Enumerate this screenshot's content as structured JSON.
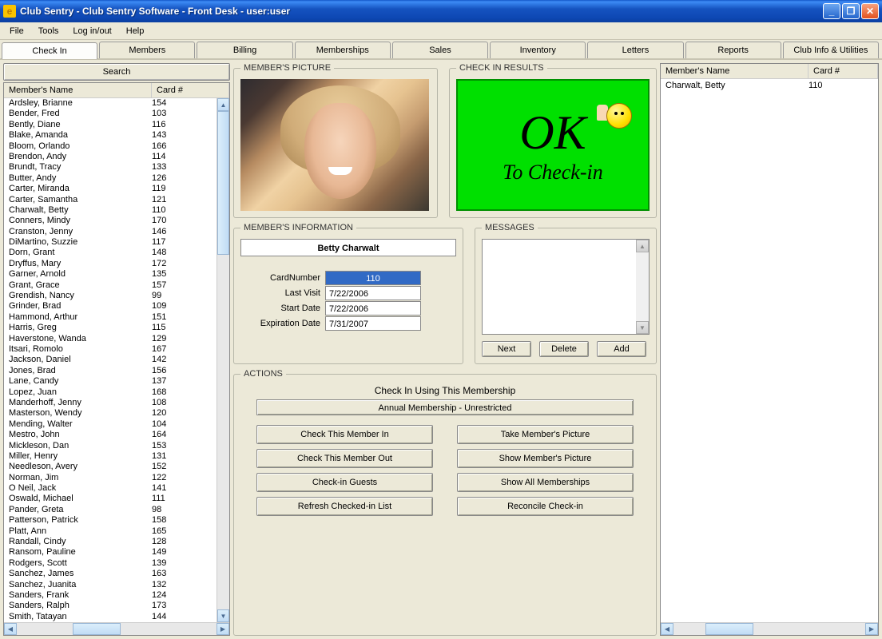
{
  "window": {
    "title": "Club Sentry - Club Sentry Software - Front Desk - user:user"
  },
  "menu": [
    "File",
    "Tools",
    "Log in/out",
    "Help"
  ],
  "tabs": [
    "Check In",
    "Members",
    "Billing",
    "Memberships",
    "Sales",
    "Inventory",
    "Letters",
    "Reports",
    "Club Info & Utilities"
  ],
  "search_label": "Search",
  "list": {
    "headers": {
      "name": "Member's Name",
      "card": "Card #"
    },
    "rows": [
      {
        "name": "Ardsley, Brianne",
        "card": "154"
      },
      {
        "name": "Bender, Fred",
        "card": "103"
      },
      {
        "name": "Bently, Diane",
        "card": "116"
      },
      {
        "name": "Blake, Amanda",
        "card": "143"
      },
      {
        "name": "Bloom, Orlando",
        "card": "166"
      },
      {
        "name": "Brendon, Andy",
        "card": "114"
      },
      {
        "name": "Brundt, Tracy",
        "card": "133"
      },
      {
        "name": "Butter, Andy",
        "card": "126"
      },
      {
        "name": "Carter, Miranda",
        "card": "119"
      },
      {
        "name": "Carter, Samantha",
        "card": "121"
      },
      {
        "name": "Charwalt, Betty",
        "card": "110"
      },
      {
        "name": "Conners, Mindy",
        "card": "170"
      },
      {
        "name": "Cranston, Jenny",
        "card": "146"
      },
      {
        "name": "DiMartino, Suzzie",
        "card": "117"
      },
      {
        "name": "Dorn, Grant",
        "card": "148"
      },
      {
        "name": "Dryffus, Mary",
        "card": "172"
      },
      {
        "name": "Garner, Arnold",
        "card": "135"
      },
      {
        "name": "Grant, Grace",
        "card": "157"
      },
      {
        "name": "Grendish, Nancy",
        "card": "99"
      },
      {
        "name": "Grinder, Brad",
        "card": "109"
      },
      {
        "name": "Hammond, Arthur",
        "card": "151"
      },
      {
        "name": "Harris, Greg",
        "card": "115"
      },
      {
        "name": "Haverstone, Wanda",
        "card": "129"
      },
      {
        "name": "Itsari, Romolo",
        "card": "167"
      },
      {
        "name": "Jackson, Daniel",
        "card": "142"
      },
      {
        "name": "Jones, Brad",
        "card": "156"
      },
      {
        "name": "Lane, Candy",
        "card": "137"
      },
      {
        "name": "Lopez, Juan",
        "card": "168"
      },
      {
        "name": "Manderhoff, Jenny",
        "card": "108"
      },
      {
        "name": "Masterson, Wendy",
        "card": "120"
      },
      {
        "name": "Mending, Walter",
        "card": "104"
      },
      {
        "name": "Mestro, John",
        "card": "164"
      },
      {
        "name": "Mickleson, Dan",
        "card": "153"
      },
      {
        "name": "Miller, Henry",
        "card": "131"
      },
      {
        "name": "Needleson, Avery",
        "card": "152"
      },
      {
        "name": "Norman, Jim",
        "card": "122"
      },
      {
        "name": "O Neil, Jack",
        "card": "141"
      },
      {
        "name": "Oswald, Michael",
        "card": "111"
      },
      {
        "name": "Pander, Greta",
        "card": "98"
      },
      {
        "name": "Patterson, Patrick",
        "card": "158"
      },
      {
        "name": "Platt, Ann",
        "card": "165"
      },
      {
        "name": "Randall, Cindy",
        "card": "128"
      },
      {
        "name": "Ransom, Pauline",
        "card": "149"
      },
      {
        "name": "Rodgers, Scott",
        "card": "139"
      },
      {
        "name": "Sanchez, James",
        "card": "163"
      },
      {
        "name": "Sanchez, Juanita",
        "card": "132"
      },
      {
        "name": "Sanders, Frank",
        "card": "124"
      },
      {
        "name": "Sanders, Ralph",
        "card": "173"
      },
      {
        "name": "Smith, Tatayan",
        "card": "144"
      }
    ]
  },
  "picture": {
    "legend": "MEMBER'S PICTURE"
  },
  "checkin": {
    "legend": "CHECK IN RESULTS",
    "ok": "OK",
    "sub": "To Check-in"
  },
  "info": {
    "legend": "MEMBER'S INFORMATION",
    "name": "Betty Charwalt",
    "fields": {
      "card_label": "CardNumber",
      "card": "110",
      "last_label": "Last Visit",
      "last": "7/22/2006",
      "start_label": "Start Date",
      "start": "7/22/2006",
      "exp_label": "Expiration Date",
      "exp": "7/31/2007"
    }
  },
  "messages": {
    "legend": "MESSAGES",
    "next": "Next",
    "delete": "Delete",
    "add": "Add"
  },
  "actions": {
    "legend": "ACTIONS",
    "title": "Check In Using This Membership",
    "membership": "Annual Membership - Unrestricted",
    "buttons": [
      "Check This Member In",
      "Take Member's Picture",
      "Check This Member Out",
      "Show Member's Picture",
      "Check-in Guests",
      "Show All Memberships",
      "Refresh Checked-in List",
      "Reconcile Check-in"
    ]
  },
  "right": {
    "headers": {
      "name": "Member's Name",
      "card": "Card #"
    },
    "rows": [
      {
        "name": "Charwalt, Betty",
        "card": "110"
      }
    ]
  }
}
